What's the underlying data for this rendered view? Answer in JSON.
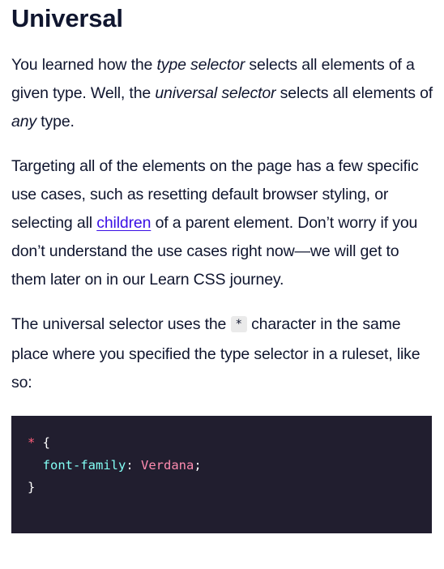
{
  "heading": "Universal",
  "para1": {
    "t1": "You learned how the ",
    "em1": "type selector",
    "t2": " selects all elements of a given type. Well, the ",
    "em2": "universal selector",
    "t3": " selects all elements of ",
    "em3": "any",
    "t4": " type."
  },
  "para2": {
    "t1": "Targeting all of the elements on the page has a few specific use cases, such as resetting default browser styling, or selecting all ",
    "link": "children",
    "t2": " of a parent element. Don’t worry if you don’t understand the use cases right now—we will get to them later on in our Learn CSS journey."
  },
  "para3": {
    "t1": "The universal selector uses the ",
    "code": "*",
    "t2": " character in the same place where you specified the type selector in a ruleset, like so:"
  },
  "code_block": {
    "line1_selector": "*",
    "line1_brace": " {",
    "line2_indent": "  ",
    "line2_property": "font-family",
    "line2_colon": ": ",
    "line2_value": "Verdana",
    "line2_semicolon": ";",
    "line3_brace": "}"
  },
  "colors": {
    "text": "#10162f",
    "link": "#3a10e5",
    "code_bg": "#211e2f",
    "selector": "#ff5e7a",
    "property": "#83fff5",
    "value": "#ff8cb0"
  }
}
